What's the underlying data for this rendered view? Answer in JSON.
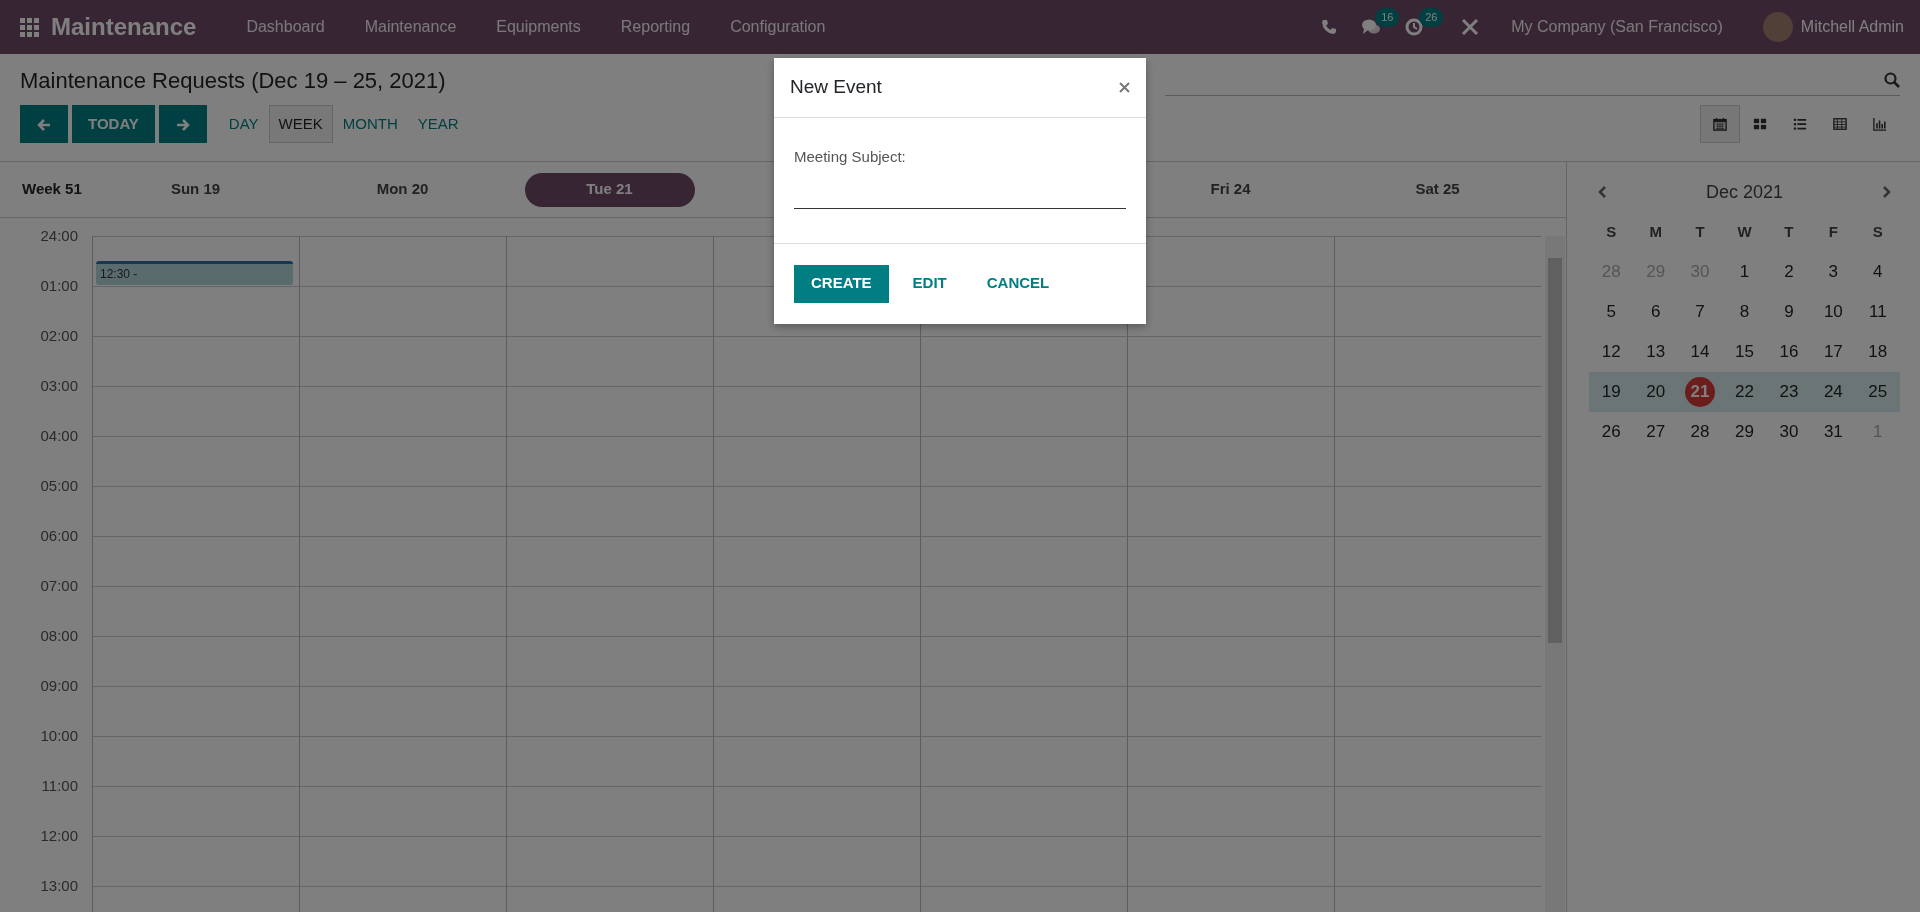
{
  "navbar": {
    "app_name": "Maintenance",
    "menu": [
      "Dashboard",
      "Maintenance",
      "Equipments",
      "Reporting",
      "Configuration"
    ],
    "systray": {
      "messages_count": "16",
      "activities_count": "26",
      "company": "My Company (San Francisco)",
      "user": "Mitchell Admin"
    }
  },
  "control_panel": {
    "title": "Maintenance Requests (Dec 19 – 25, 2021)",
    "today_button": "TODAY",
    "scales": [
      {
        "label": "DAY",
        "selected": false
      },
      {
        "label": "WEEK",
        "selected": true
      },
      {
        "label": "MONTH",
        "selected": false
      },
      {
        "label": "YEAR",
        "selected": false
      }
    ],
    "views": [
      {
        "kind": "calendar",
        "selected": true
      },
      {
        "kind": "kanban",
        "selected": false
      },
      {
        "kind": "list",
        "selected": false
      },
      {
        "kind": "pivot",
        "selected": false
      },
      {
        "kind": "graph",
        "selected": false
      }
    ]
  },
  "calendar": {
    "week_label": "Week 51",
    "days_left": [
      {
        "label": "Sun 19",
        "today": false,
        "events": [
          {
            "label": "12:30 -"
          }
        ]
      },
      {
        "label": "Mon 20",
        "today": false
      },
      {
        "label": "Tue 21",
        "today": true
      }
    ],
    "days_right": [
      {
        "label": "Fri 24",
        "today": false
      },
      {
        "label": "Sat 25",
        "today": false
      }
    ],
    "hours": [
      "24:00",
      "01:00",
      "02:00",
      "03:00",
      "04:00",
      "05:00",
      "06:00",
      "07:00",
      "08:00",
      "09:00",
      "10:00",
      "11:00",
      "12:00",
      "13:00"
    ]
  },
  "mini_calendar": {
    "month": "Dec 2021",
    "weekdays": [
      "S",
      "M",
      "T",
      "W",
      "T",
      "F",
      "S"
    ],
    "weeks": [
      {
        "selected": false,
        "days": [
          {
            "label": "28",
            "other_month": true,
            "today": false
          },
          {
            "label": "29",
            "other_month": true,
            "today": false
          },
          {
            "label": "30",
            "other_month": true,
            "today": false
          },
          {
            "label": "1",
            "other_month": false,
            "today": false
          },
          {
            "label": "2",
            "other_month": false,
            "today": false
          },
          {
            "label": "3",
            "other_month": false,
            "today": false
          },
          {
            "label": "4",
            "other_month": false,
            "today": false
          }
        ]
      },
      {
        "selected": false,
        "days": [
          {
            "label": "5",
            "other_month": false,
            "today": false
          },
          {
            "label": "6",
            "other_month": false,
            "today": false
          },
          {
            "label": "7",
            "other_month": false,
            "today": false
          },
          {
            "label": "8",
            "other_month": false,
            "today": false
          },
          {
            "label": "9",
            "other_month": false,
            "today": false
          },
          {
            "label": "10",
            "other_month": false,
            "today": false
          },
          {
            "label": "11",
            "other_month": false,
            "today": false
          }
        ]
      },
      {
        "selected": false,
        "days": [
          {
            "label": "12",
            "other_month": false,
            "today": false
          },
          {
            "label": "13",
            "other_month": false,
            "today": false
          },
          {
            "label": "14",
            "other_month": false,
            "today": false
          },
          {
            "label": "15",
            "other_month": false,
            "today": false
          },
          {
            "label": "16",
            "other_month": false,
            "today": false
          },
          {
            "label": "17",
            "other_month": false,
            "today": false
          },
          {
            "label": "18",
            "other_month": false,
            "today": false
          }
        ]
      },
      {
        "selected": true,
        "days": [
          {
            "label": "19",
            "other_month": false,
            "today": false
          },
          {
            "label": "20",
            "other_month": false,
            "today": false
          },
          {
            "label": "21",
            "other_month": false,
            "today": true
          },
          {
            "label": "22",
            "other_month": false,
            "today": false
          },
          {
            "label": "23",
            "other_month": false,
            "today": false
          },
          {
            "label": "24",
            "other_month": false,
            "today": false
          },
          {
            "label": "25",
            "other_month": false,
            "today": false
          }
        ]
      },
      {
        "selected": false,
        "days": [
          {
            "label": "26",
            "other_month": false,
            "today": false
          },
          {
            "label": "27",
            "other_month": false,
            "today": false
          },
          {
            "label": "28",
            "other_month": false,
            "today": false
          },
          {
            "label": "29",
            "other_month": false,
            "today": false
          },
          {
            "label": "30",
            "other_month": false,
            "today": false
          },
          {
            "label": "31",
            "other_month": false,
            "today": false
          },
          {
            "label": "1",
            "other_month": true,
            "today": false
          }
        ]
      }
    ]
  },
  "dialog": {
    "title": "New Event",
    "field_label": "Meeting Subject:",
    "buttons": [
      {
        "label": "CREATE",
        "kind": "primary"
      },
      {
        "label": "EDIT",
        "kind": "link"
      },
      {
        "label": "CANCEL",
        "kind": "link"
      }
    ]
  }
}
